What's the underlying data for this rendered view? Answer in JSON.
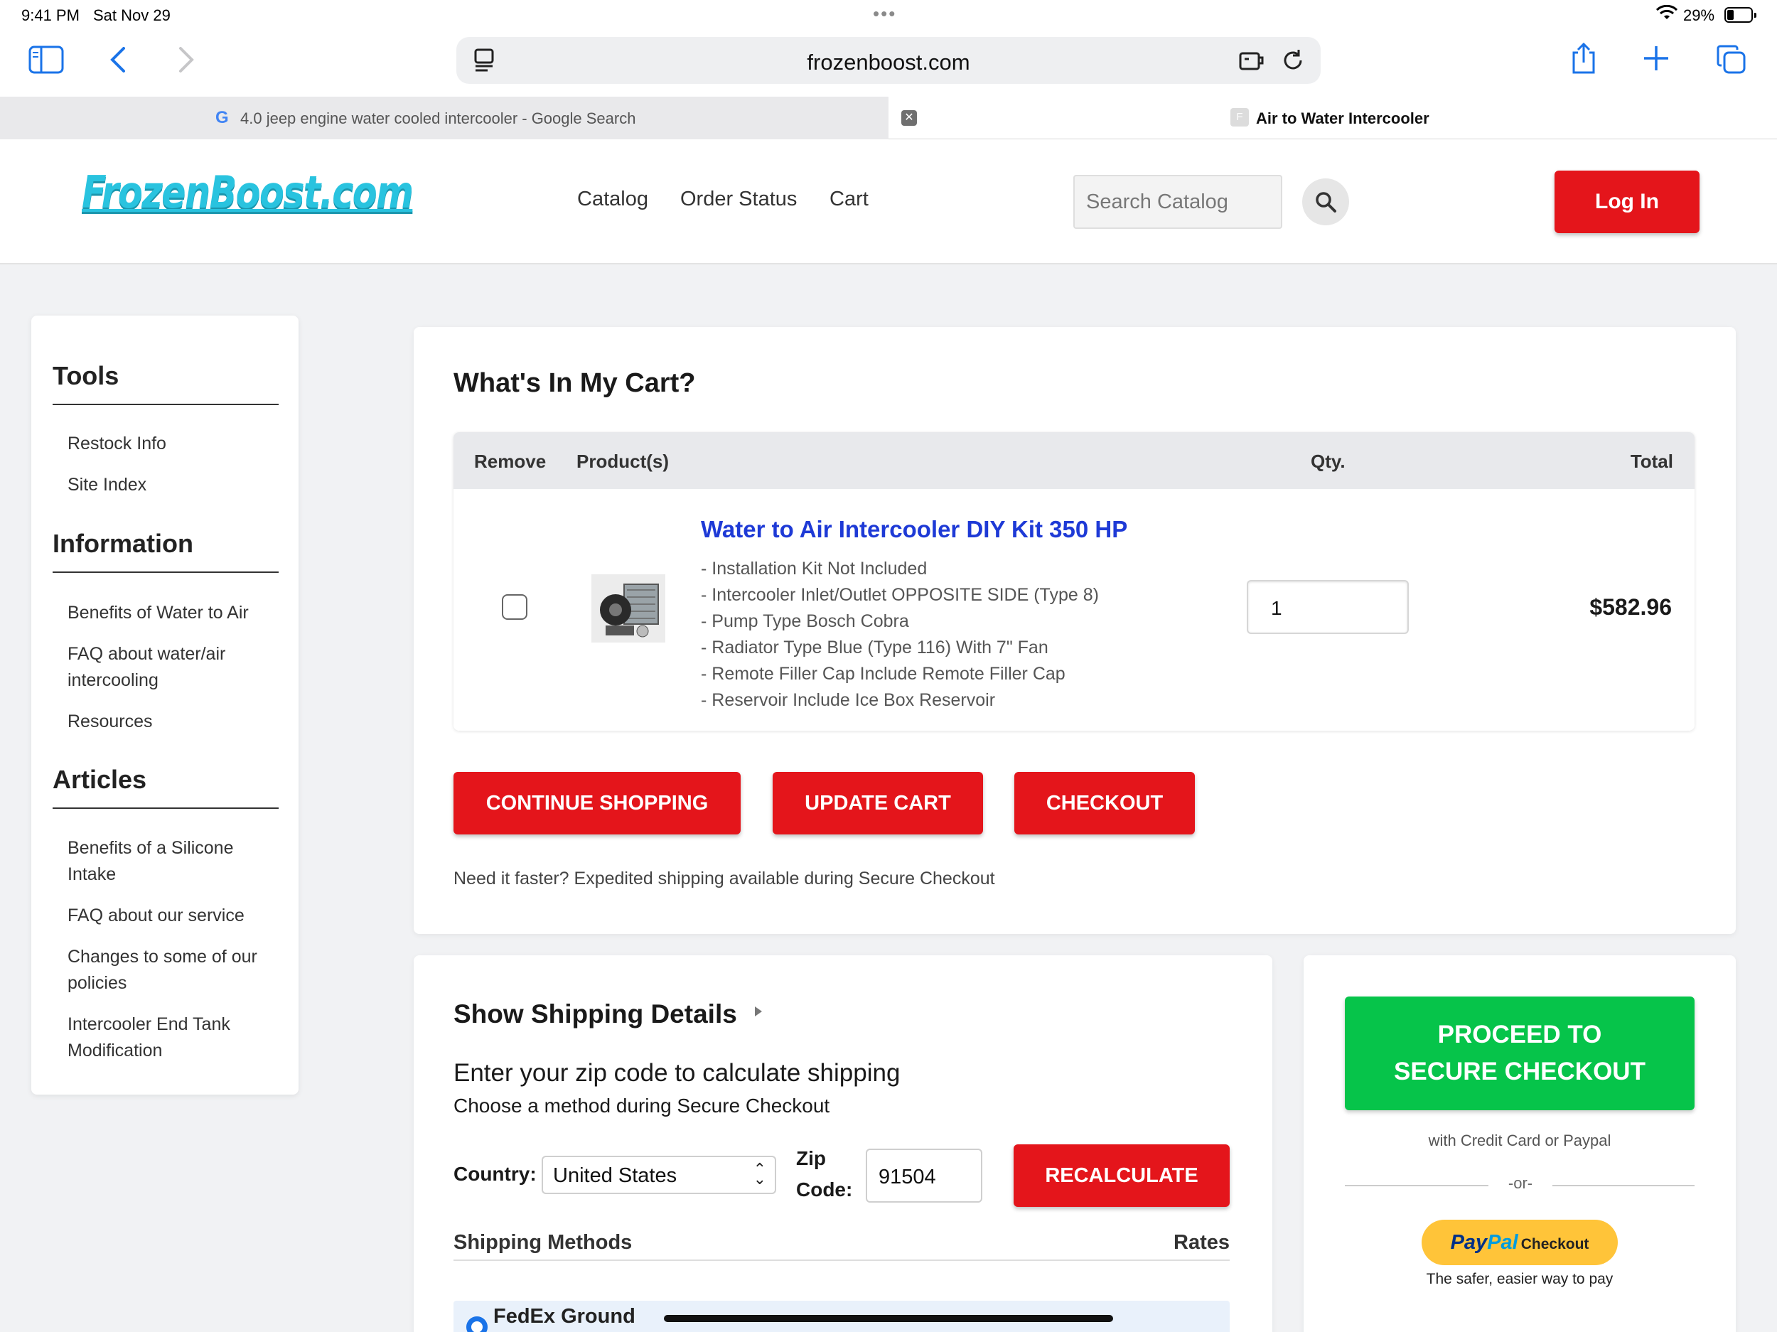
{
  "status_bar": {
    "time": "9:41 PM",
    "date": "Sat Nov 29",
    "battery": "29%"
  },
  "browser": {
    "url": "frozenboost.com",
    "tabs": [
      {
        "title": "4.0 jeep engine water cooled intercooler - Google Search",
        "favicon": "G"
      },
      {
        "title": "Air to Water Intercooler",
        "favicon": "F"
      }
    ]
  },
  "header": {
    "logo": "FrozenBoost.com",
    "nav": [
      "Catalog",
      "Order Status",
      "Cart"
    ],
    "search_placeholder": "Search Catalog",
    "login_label": "Log In"
  },
  "sidebar": {
    "sections": [
      {
        "title": "Tools",
        "items": [
          "Restock Info",
          "Site Index"
        ]
      },
      {
        "title": "Information",
        "items": [
          "Benefits of Water to Air",
          "FAQ about water/air intercooling",
          "Resources"
        ]
      },
      {
        "title": "Articles",
        "items": [
          "Benefits of a Silicone Intake",
          "FAQ about our service",
          "Changes to some of our policies",
          "Intercooler End Tank Modification"
        ]
      }
    ]
  },
  "cart": {
    "title": "What's In My Cart?",
    "columns": {
      "remove": "Remove",
      "product": "Product(s)",
      "qty": "Qty.",
      "total": "Total"
    },
    "item": {
      "name": "Water to Air Intercooler DIY Kit 350 HP",
      "options": [
        "- Installation Kit Not Included",
        "- Intercooler Inlet/Outlet OPPOSITE SIDE (Type 8)",
        "- Pump Type Bosch Cobra",
        "- Radiator Type Blue (Type 116) With 7\" Fan",
        "- Remote Filler Cap Include Remote Filler Cap",
        "- Reservoir Include Ice Box Reservoir"
      ],
      "qty": "1",
      "total": "$582.96"
    },
    "buttons": {
      "continue": "CONTINUE SHOPPING",
      "update": "UPDATE CART",
      "checkout": "CHECKOUT"
    },
    "shipping_note": "Need it faster? Expedited shipping available during Secure Checkout"
  },
  "shipping": {
    "title": "Show Shipping Details",
    "zip_prompt": "Enter your zip code to calculate shipping",
    "method_prompt": "Choose a method during Secure Checkout",
    "country_label": "Country:",
    "country_value": "United States",
    "zip_label_1": "Zip",
    "zip_label_2": "Code:",
    "zip_value": "91504",
    "recalculate": "RECALCULATE",
    "methods_header": "Shipping Methods",
    "rates_header": "Rates",
    "method_1": "FedEx Ground"
  },
  "checkout_box": {
    "proceed_line1": "PROCEED TO",
    "proceed_line2": "SECURE CHECKOUT",
    "cc_note": "with Credit Card or Paypal",
    "or": "-or-",
    "paypal_pay": "Pay",
    "paypal_pal": "Pal",
    "paypal_checkout": "Checkout",
    "paypal_tagline": "The safer, easier way to pay"
  },
  "colors": {
    "accent_red": "#e4151b",
    "proceed_green": "#06c44a",
    "link_blue": "#1e3ad6",
    "logo_cyan": "#29c3df",
    "paypal_yellow": "#ffc439"
  }
}
